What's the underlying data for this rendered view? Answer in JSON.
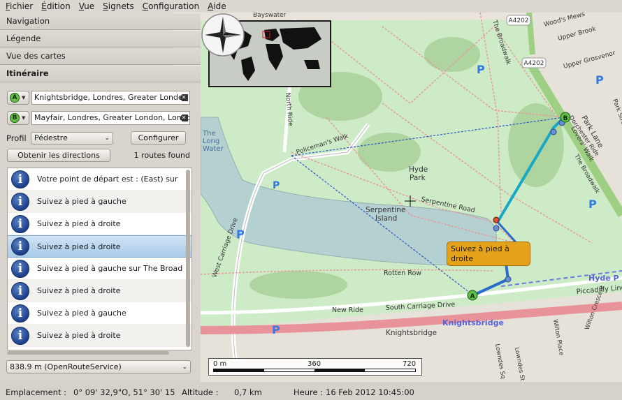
{
  "menubar": {
    "items": [
      {
        "label": "Fichier"
      },
      {
        "label": "Édition"
      },
      {
        "label": "Vue"
      },
      {
        "label": "Signets"
      },
      {
        "label": "Configuration"
      },
      {
        "label": "Aide"
      }
    ]
  },
  "panel": {
    "sections": [
      {
        "label": "Navigation"
      },
      {
        "label": "Légende"
      },
      {
        "label": "Vue des cartes"
      },
      {
        "label": "Itinéraire"
      }
    ],
    "route": {
      "start": {
        "marker": "A",
        "value": "Knightsbridge, Londres, Greater London"
      },
      "end": {
        "marker": "B",
        "value": "Mayfair, Londres, Greater London, London"
      }
    },
    "profile_label": "Profil",
    "profile_value": "Pédestre",
    "configure_label": "Configurer",
    "get_directions_label": "Obtenir les directions",
    "routes_found": "1 routes found",
    "instructions": [
      {
        "text": "Votre point de départ est : (East) sur"
      },
      {
        "text": "Suivez à pied à gauche"
      },
      {
        "text": "Suivez à pied à droite"
      },
      {
        "text": "Suivez à pied à droite"
      },
      {
        "text": "Suivez à pied à gauche sur The Broad"
      },
      {
        "text": "Suivez à pied à droite"
      },
      {
        "text": "Suivez à pied à gauche"
      },
      {
        "text": "Suivez à pied à droite"
      }
    ],
    "route_summary": "838.9 m (OpenRouteService)"
  },
  "map": {
    "bubble_text": "Suivez à pied à droite",
    "labels": {
      "hyde_park": "Hyde\nPark",
      "serpentine_island": "Serpentine\nIsland",
      "serpentine_road": "Serpentine Road",
      "long_water": "The\nLong\nWater",
      "rotten_row": "Rotten Row",
      "new_ride": "New Ride",
      "south_carriage_drive": "South Carriage Drive",
      "knightsbridge_road": "Knightsbridge",
      "knightsbridge_place": "Knightsbridge",
      "piccadilly_line": "Piccadilly Line",
      "hyde_park_corner": "Hyde P",
      "park_lane": "Park Lane",
      "the_broadwalk": "The Broadwalk",
      "lovers_walk": "Lovers' Walk",
      "north_ride": "North Ride",
      "policemans_walk": "Policeman's Walk",
      "west_carriage_drive": "West Carriage Drive",
      "woods_mews": "Wood's Mews",
      "upper_brook": "Upper Brook",
      "upper_grosvenor": "Upper Grosvenor",
      "a4202_a": "A4202",
      "a4202_b": "A4202",
      "bayswater": "Bayswater",
      "parking": "P",
      "wilton_place": "Wilton Place",
      "wilton_crescent": "Wilton Crescent",
      "lowndes_sq": "Lowndes Sq",
      "lowndes_st": "Lowndes St",
      "park_street": "Park Street",
      "dorchester_ride": "Dorchester Ride",
      "the_broadwalk2": "The Broadwalk",
      "marker_a": "A",
      "marker_b": "B"
    },
    "scale": {
      "zero": "0 m",
      "mid": "360",
      "end": "720"
    }
  },
  "statusbar": {
    "location_label": "Emplacement :",
    "location_value": "0° 09' 32,9\"O,  51° 30' 15",
    "altitude_label": "Altitude :",
    "altitude_value": "0,7 km",
    "time_label": "Heure :",
    "time_value": "16 Feb 2012 10:45:00"
  }
}
